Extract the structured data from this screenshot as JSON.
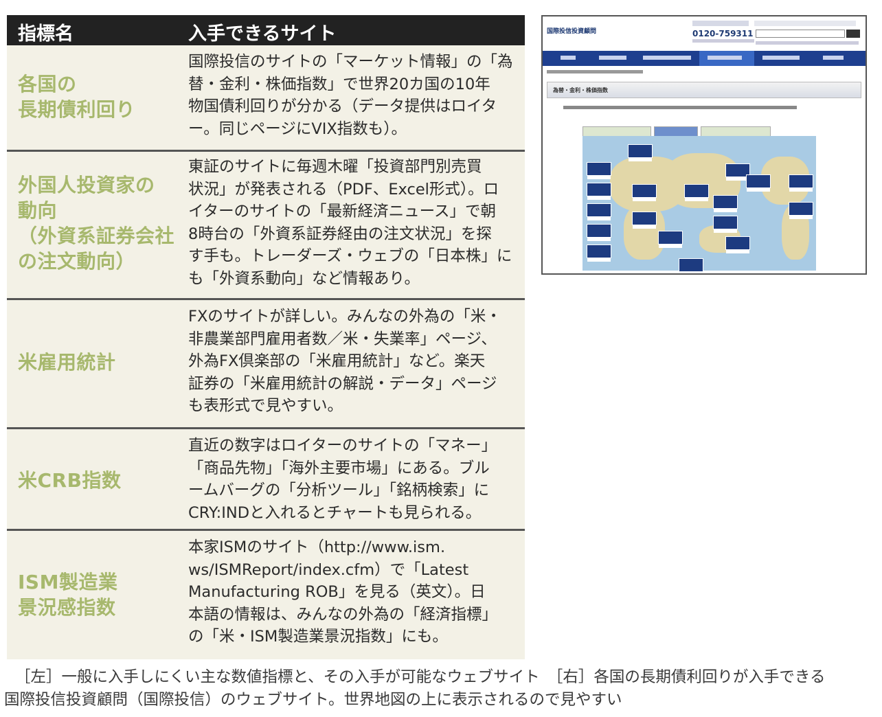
{
  "table": {
    "headers": [
      "指標名",
      "入手できるサイト"
    ],
    "rows": [
      {
        "name": "各国の\n長期債利回り",
        "site": "国際投信のサイトの「マーケット情報」の「為\n替・金利・株価指数」で世界20カ国の10年\n物国債利回りが分かる（データ提供はロイタ\nー。同じページにVIX指数も）。"
      },
      {
        "name": "外国人投資家の\n動向\n（外資系証券会社\nの注文動向）",
        "site": "東証のサイトに毎週木曜「投資部門別売買\n状況」が発表される（PDF、Excel形式）。ロ\nイターのサイトの「最新経済ニュース」で朝\n8時台の「外資系証券経由の注文状況」を探\nす手も。トレーダーズ・ウェブの「日本株」に\nも「外資系動向」など情報あり。"
      },
      {
        "name": "米雇用統計",
        "site": "FXのサイトが詳しい。みんなの外為の「米・\n非農業部門雇用者数／米・失業率」ページ、\n外為FX倶楽部の「米雇用統計」など。楽天\n証券の「米雇用統計の解説・データ」ページ\nも表形式で見やすい。"
      },
      {
        "name": "米CRB指数",
        "site": "直近の数字はロイターのサイトの「マネー」\n「商品先物」「海外主要市場」にある。ブル\nームバーグの「分析ツール」「銘柄検索」に\nCRY:INDと入れるとチャートも見られる。"
      },
      {
        "name": "ISM製造業\n景況感指数",
        "site": "本家ISMのサイト（http://www.ism.\nws/ISMReport/index.cfm）で「Latest\nManufacturing ROB」を見る（英文）。日\n本語の情報は、みんなの外為の「経済指標」\nの「米・ISM製造業景況指数」にも。"
      }
    ]
  },
  "screenshot": {
    "logo": "国際投信投資顧問",
    "phone": "0120-759311",
    "page_title": "為替・金利・株価指数",
    "colors": {
      "nav": "#1e3f8f",
      "map_sea": "#a9cbe4",
      "land": "#e2d7a8"
    }
  },
  "caption": {
    "line1": "［左］一般に入手しにくい主な数値指標と、その入手が可能なウェブサイト　［右］各国の長期債利回りが入手できる",
    "line2": "国際投信投資顧問（国際投信）のウェブサイト。世界地図の上に表示されるので見やすい"
  }
}
